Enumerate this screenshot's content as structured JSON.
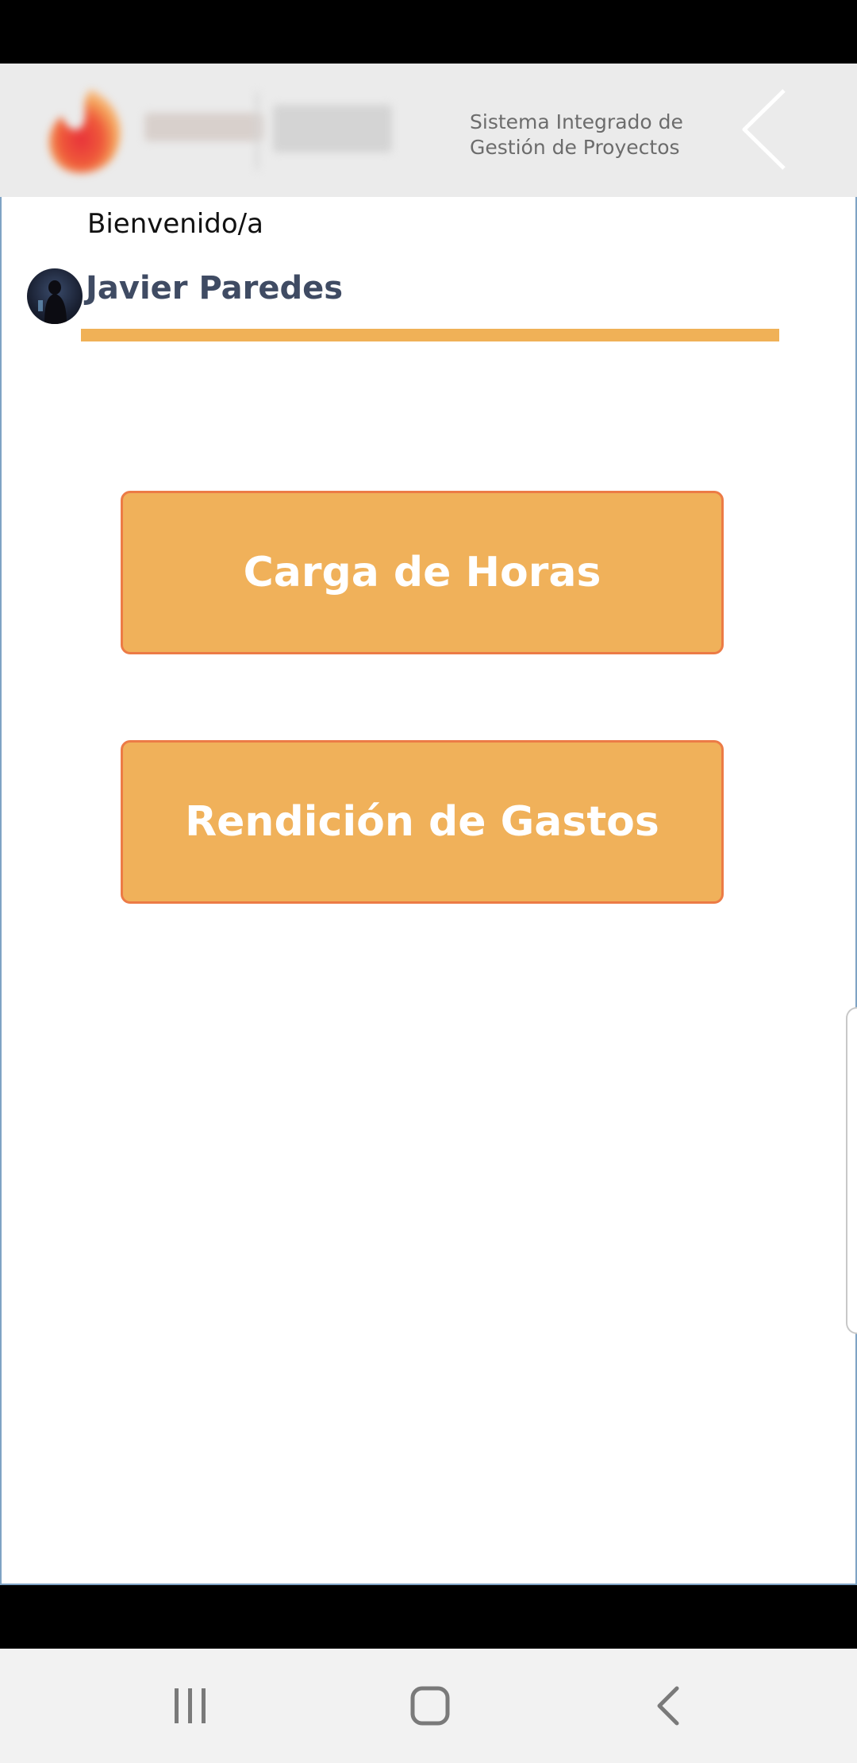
{
  "header": {
    "system_title_line1": "Sistema Integrado de",
    "system_title_line2": "Gestión de Proyectos",
    "back_icon": "chevron-left-icon",
    "logo_icon": "company-logo"
  },
  "main": {
    "welcome_text": "Bienvenido/a",
    "user_name": "Javier Paredes",
    "avatar_icon": "user-avatar",
    "buttons": [
      {
        "label": "Carga de Horas"
      },
      {
        "label": "Rendición de Gastos"
      }
    ]
  },
  "navigation": {
    "recents_icon": "recent-apps-icon",
    "home_icon": "home-icon",
    "back_icon": "back-icon"
  },
  "colors": {
    "accent": "#f0b15a",
    "button_border": "#ec7b46",
    "name_text": "#3f4b63",
    "header_bg": "#ebebeb"
  }
}
